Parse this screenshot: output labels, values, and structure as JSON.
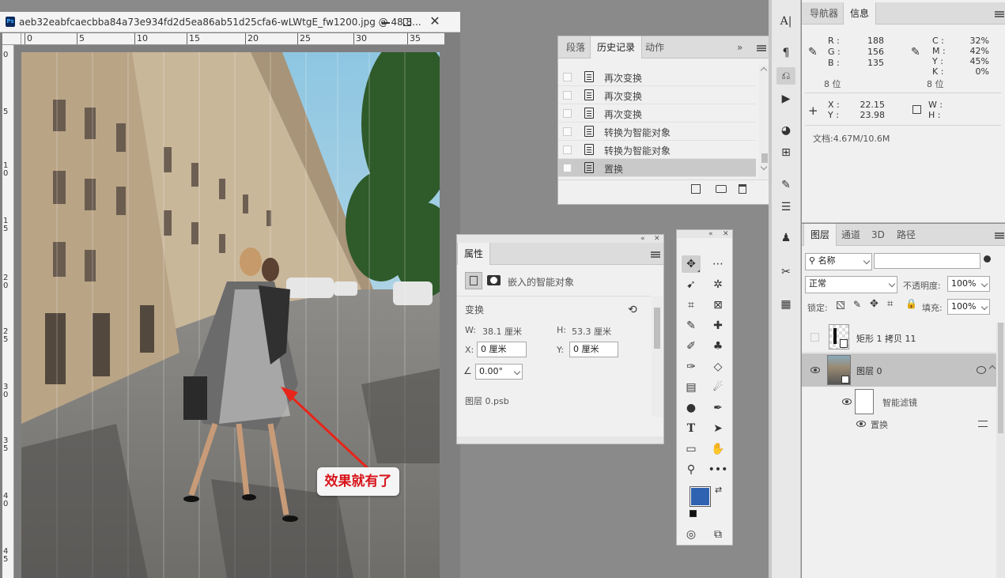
{
  "document": {
    "title": "aeb32eabfcaecbba84a73e934fd2d5ea86ab51d25cfa6-wLWtgE_fw1200.jpg @ 48.8...",
    "ruler_h_ticks": [
      "0",
      "5",
      "10",
      "15",
      "20",
      "25",
      "30",
      "35"
    ],
    "ruler_v_ticks": [
      "0",
      "5",
      "10",
      "15",
      "20",
      "25",
      "30",
      "35",
      "40",
      "45"
    ],
    "annotation": "效果就有了",
    "colors": {
      "arrow": "#e8251a",
      "annotation_text": "#d8141a"
    }
  },
  "history_panel": {
    "tabs": [
      "段落",
      "历史记录",
      "动作"
    ],
    "active_tab": "历史记录",
    "items": [
      "再次变换",
      "再次变换",
      "再次变换",
      "转换为智能对象",
      "转换为智能对象",
      "置换"
    ],
    "selected_item": "置换"
  },
  "properties_panel": {
    "tab": "属性",
    "object_type": "嵌入的智能对象",
    "section": "变换",
    "w_label": "W:",
    "w_value": "38.1 厘米",
    "h_label": "H:",
    "h_value": "53.3 厘米",
    "x_label": "X:",
    "x_value": "0 厘米",
    "y_label": "Y:",
    "y_value": "0 厘米",
    "angle_value": "0.00°",
    "linked_file": "图层 0.psb"
  },
  "info_panel": {
    "tabs": [
      "导航器",
      "信息"
    ],
    "active_tab": "信息",
    "rgb_labels": [
      "R :",
      "G :",
      "B :"
    ],
    "rgb_values": [
      "188",
      "156",
      "135"
    ],
    "cmyk_labels": [
      "C :",
      "M :",
      "Y :",
      "K :"
    ],
    "cmyk_values": [
      "32%",
      "42%",
      "45%",
      "0%"
    ],
    "bit_depth_left": "8 位",
    "bit_depth_right": "8 位",
    "x_label": "X :",
    "x_value": "22.15",
    "y_label": "Y :",
    "y_value": "23.98",
    "w_label": "W :",
    "h_label": "H :",
    "doc_size": "文档:4.67M/10.6M"
  },
  "layers_panel": {
    "tabs": [
      "图层",
      "通道",
      "3D",
      "路径"
    ],
    "active_tab": "图层",
    "filter_kind": "名称",
    "blend_mode": "正常",
    "opacity_label": "不透明度:",
    "opacity_value": "100%",
    "lock_label": "锁定:",
    "fill_label": "填充:",
    "fill_value": "100%",
    "layers": [
      {
        "name": "矩形 1 拷贝 11",
        "visible": false
      },
      {
        "name": "图层 0",
        "visible": true,
        "selected": true
      }
    ],
    "smart_filter_label": "智能滤镜",
    "filter_name": "置换"
  }
}
